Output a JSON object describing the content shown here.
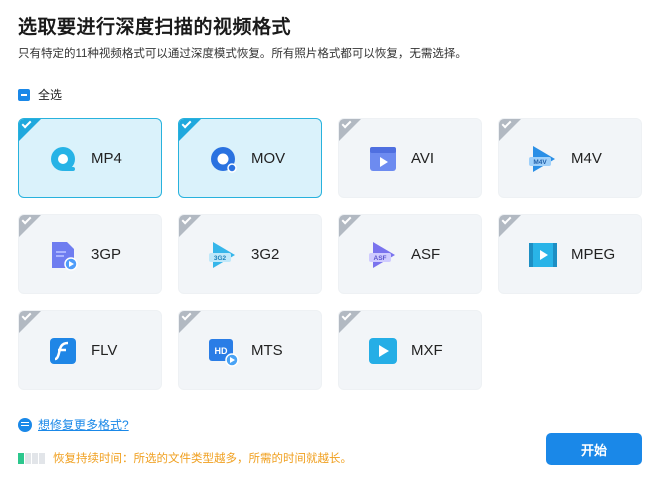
{
  "header": {
    "title": "选取要进行深度扫描的视频格式",
    "subtitle": "只有特定的11种视频格式可以通过深度模式恢复。所有照片格式都可以恢复，无需选择。"
  },
  "select_all": {
    "label": "全选",
    "state": "partial"
  },
  "formats": [
    {
      "label": "MP4",
      "selected": true,
      "icon": "mp4-icon"
    },
    {
      "label": "MOV",
      "selected": true,
      "icon": "mov-icon"
    },
    {
      "label": "AVI",
      "selected": false,
      "icon": "avi-icon"
    },
    {
      "label": "M4V",
      "selected": false,
      "icon": "m4v-icon",
      "icon_text": "M4V"
    },
    {
      "label": "3GP",
      "selected": false,
      "icon": "3gp-icon"
    },
    {
      "label": "3G2",
      "selected": false,
      "icon": "3g2-icon",
      "icon_text": "3G2"
    },
    {
      "label": "ASF",
      "selected": false,
      "icon": "asf-icon",
      "icon_text": "ASF"
    },
    {
      "label": "MPEG",
      "selected": false,
      "icon": "mpeg-icon"
    },
    {
      "label": "FLV",
      "selected": false,
      "icon": "flv-icon"
    },
    {
      "label": "MTS",
      "selected": false,
      "icon": "mts-icon",
      "icon_text": "HD"
    },
    {
      "label": "MXF",
      "selected": false,
      "icon": "mxf-icon"
    }
  ],
  "footer": {
    "more_formats_link": "想修复更多格式?",
    "status_text": "恢复持续时间：所选的文件类型越多，所需的时间就越长。",
    "progress_segments_filled": 1,
    "progress_segments_total": 4,
    "start_button": "开始"
  },
  "colors": {
    "accent": "#1a88e8",
    "selected_border": "#28b2dd",
    "selected_bg": "#daf2fb",
    "warning_text": "#f0a020",
    "progress_fill": "#2cc78d"
  }
}
